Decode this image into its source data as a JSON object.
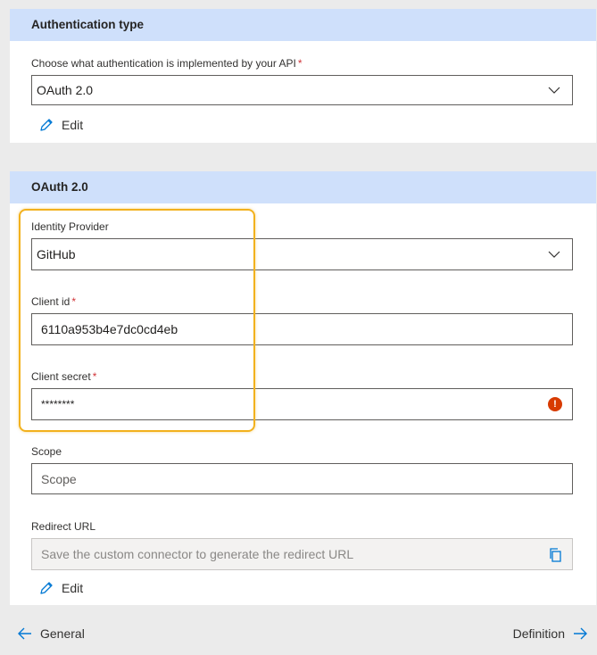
{
  "auth_section": {
    "title": "Authentication type",
    "label": "Choose what authentication is implemented by your API",
    "required_mark": "*",
    "selected": "OAuth 2.0",
    "edit_label": "Edit"
  },
  "oauth_section": {
    "title": "OAuth 2.0",
    "identity_provider": {
      "label": "Identity Provider",
      "selected": "GitHub"
    },
    "client_id": {
      "label": "Client id",
      "required_mark": "*",
      "value": "6110a953b4e7dc0cd4eb"
    },
    "client_secret": {
      "label": "Client secret",
      "required_mark": "*",
      "value": "********",
      "error_glyph": "!"
    },
    "scope": {
      "label": "Scope",
      "placeholder": "Scope"
    },
    "redirect_url": {
      "label": "Redirect URL",
      "value": "Save the custom connector to generate the redirect URL"
    },
    "edit_label": "Edit"
  },
  "footer": {
    "prev_label": "General",
    "next_label": "Definition"
  },
  "colors": {
    "header_bg": "#cfe0fb",
    "highlight": "#f2b11d",
    "accent": "#0078d4",
    "error": "#d83b01",
    "required": "#d13438"
  }
}
